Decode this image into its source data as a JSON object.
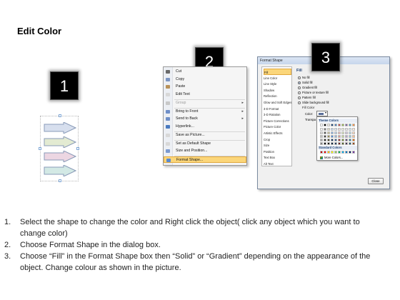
{
  "title": "Edit Color",
  "badges": {
    "step1": "1",
    "step2": "2",
    "step3": "3"
  },
  "arrow_colors": [
    "#d7dfee",
    "#e3ebd2",
    "#ecd6e2",
    "#d3e9e5"
  ],
  "context_menu": {
    "items": [
      {
        "label": "Cut",
        "icon": "scissors-icon",
        "color": "#6a6a6a",
        "disabled": false
      },
      {
        "label": "Copy",
        "icon": "copy-icon",
        "color": "#7c96c4",
        "disabled": false
      },
      {
        "label": "Paste",
        "icon": "paste-icon",
        "color": "#b8925a",
        "disabled": false
      },
      {
        "label": "Edit Text",
        "icon": "edit-text-icon",
        "color": "#d8d8d8",
        "disabled": false
      },
      {
        "label": "Group",
        "icon": "group-icon",
        "color": "#c8c8c8",
        "disabled": true,
        "submenu": true
      },
      {
        "label": "Bring to Front",
        "icon": "bring-to-front-icon",
        "color": "#6f8fc8",
        "disabled": false,
        "submenu": true
      },
      {
        "label": "Send to Back",
        "icon": "send-to-back-icon",
        "color": "#6f8fc8",
        "disabled": false,
        "submenu": true
      },
      {
        "label": "Hyperlink...",
        "icon": "hyperlink-icon",
        "color": "#4a7ac0",
        "disabled": false
      },
      {
        "label": "Save as Picture...",
        "icon": "save-picture-icon",
        "color": "#d8d8d8",
        "disabled": false
      },
      {
        "label": "Set as Default Shape",
        "icon": "default-shape-icon",
        "color": "#d8d8d8",
        "disabled": false
      },
      {
        "label": "Size and Position...",
        "icon": "size-position-icon",
        "color": "#7a9ad0",
        "disabled": false
      },
      {
        "label": "Format Shape...",
        "icon": "format-shape-icon",
        "color": "#5a8ad0",
        "disabled": false,
        "highlight": true
      }
    ]
  },
  "dialog": {
    "title": "Format Shape",
    "nav": [
      "Fill",
      "Line Color",
      "Line Style",
      "Shadow",
      "Reflection",
      "Glow and Soft Edges",
      "3-D Format",
      "3-D Rotation",
      "Picture Corrections",
      "Picture Color",
      "Artistic Effects",
      "Crop",
      "Size",
      "Position",
      "Text Box",
      "Alt Text"
    ],
    "nav_active": "Fill",
    "pane_heading": "Fill",
    "fill_options": [
      {
        "label": "No fill",
        "selected": false
      },
      {
        "label": "Solid fill",
        "selected": true
      },
      {
        "label": "Gradient fill",
        "selected": false
      },
      {
        "label": "Picture or texture fill",
        "selected": false
      },
      {
        "label": "Pattern fill",
        "selected": false
      },
      {
        "label": "Slide background fill",
        "selected": false
      }
    ],
    "fill_color_heading": "Fill Color",
    "color_label": "Color:",
    "transparency_label": "Transpa",
    "palette": {
      "theme_heading": "Theme Colors",
      "standard_heading": "Standard Colors",
      "more_colors": "More Colors...",
      "theme_top": [
        "#ffffff",
        "#000000",
        "#eeece1",
        "#1f497d",
        "#4f81bd",
        "#c0504d",
        "#9bbb59",
        "#8064a2",
        "#4bacc6",
        "#f79646"
      ],
      "theme_rows": [
        [
          "#f2f2f2",
          "#7f7f7f",
          "#ddd9c3",
          "#c6d9f0",
          "#dbe5f1",
          "#f2dcdb",
          "#ebf1dd",
          "#e5e0ec",
          "#dbeef3",
          "#fdeada"
        ],
        [
          "#d8d8d8",
          "#595959",
          "#c4bd97",
          "#8db3e2",
          "#b8cce4",
          "#e5b9b7",
          "#d7e3bc",
          "#ccc1d9",
          "#b7dde8",
          "#fbd5b5"
        ],
        [
          "#bfbfbf",
          "#3f3f3f",
          "#938953",
          "#548dd4",
          "#95b3d7",
          "#d99694",
          "#c3d69b",
          "#b2a2c7",
          "#92cddc",
          "#fac08f"
        ],
        [
          "#a5a5a5",
          "#262626",
          "#494429",
          "#17365d",
          "#366092",
          "#953734",
          "#76923c",
          "#5f497a",
          "#31859b",
          "#e36c09"
        ],
        [
          "#7f7f7f",
          "#0c0c0c",
          "#1d1b10",
          "#0f243e",
          "#244061",
          "#632423",
          "#4f6128",
          "#3f3151",
          "#205867",
          "#974806"
        ]
      ],
      "standard": [
        "#c00000",
        "#ff0000",
        "#ffc000",
        "#ffff00",
        "#92d050",
        "#00b050",
        "#00b0f0",
        "#0070c0",
        "#002060",
        "#7030a0"
      ]
    },
    "close_label": "Close"
  },
  "instructions": [
    {
      "num": "1.",
      "text": "Select the shape to change the color and Right click the object( click any object which you want to change color)"
    },
    {
      "num": "2.",
      "text": "Choose Format Shape in the dialog box."
    },
    {
      "num": "3.",
      "text": "Choose “Fill” in the Format Shape box then “Solid” or “Gradient” depending on the appearance of the object. Change colour as shown in the picture."
    }
  ]
}
